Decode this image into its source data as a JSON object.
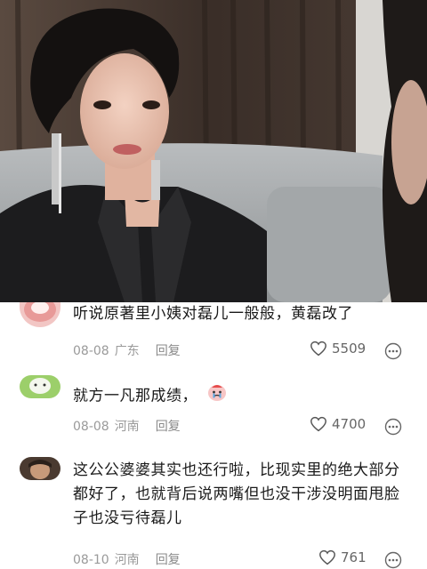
{
  "comments": [
    {
      "text": "听说原著里小姨对磊儿一般般，黄磊改了",
      "date": "08-08",
      "location": "广东",
      "reply_label": "回复",
      "likes": "5509"
    },
    {
      "text": "就方一凡那成绩，",
      "emoji": "crying-face-emoji",
      "date": "08-08",
      "location": "河南",
      "reply_label": "回复",
      "likes": "4700"
    },
    {
      "text": "这公公婆婆其实也还行啦，比现实里的绝大部分都好了，也就背后说两嘴但也没干涉没明面甩脸子也没亏待磊儿",
      "date": "08-10",
      "location": "河南",
      "reply_label": "回复",
      "likes": "761"
    }
  ],
  "icons": {
    "like": "heart-outline-icon",
    "more": "more-options-icon"
  },
  "colors": {
    "text": "#1a1a1a",
    "meta": "#9a9a9a",
    "background": "#ffffff"
  }
}
